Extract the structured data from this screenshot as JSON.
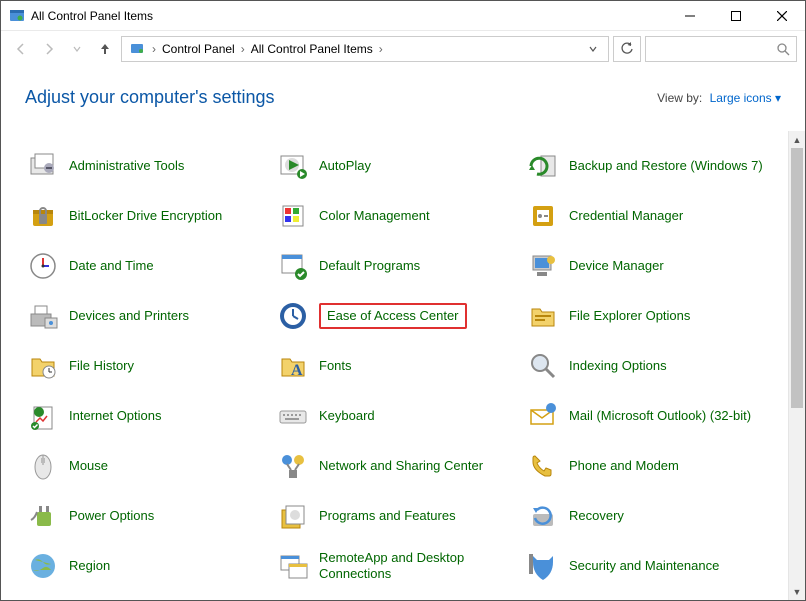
{
  "window": {
    "title": "All Control Panel Items"
  },
  "breadcrumb": {
    "seg1": "Control Panel",
    "seg2": "All Control Panel Items"
  },
  "header": {
    "title": "Adjust your computer's settings",
    "viewby_label": "View by:",
    "viewby_value": "Large icons"
  },
  "items": [
    {
      "label": "Administrative Tools",
      "icon": "admin-tools"
    },
    {
      "label": "AutoPlay",
      "icon": "autoplay"
    },
    {
      "label": "Backup and Restore (Windows 7)",
      "icon": "backup"
    },
    {
      "label": "BitLocker Drive Encryption",
      "icon": "bitlocker"
    },
    {
      "label": "Color Management",
      "icon": "color-mgmt"
    },
    {
      "label": "Credential Manager",
      "icon": "credential"
    },
    {
      "label": "Date and Time",
      "icon": "datetime"
    },
    {
      "label": "Default Programs",
      "icon": "default-programs"
    },
    {
      "label": "Device Manager",
      "icon": "device-mgr"
    },
    {
      "label": "Devices and Printers",
      "icon": "devices-printers"
    },
    {
      "label": "Ease of Access Center",
      "icon": "ease-access",
      "highlight": true
    },
    {
      "label": "File Explorer Options",
      "icon": "file-explorer"
    },
    {
      "label": "File History",
      "icon": "file-history"
    },
    {
      "label": "Fonts",
      "icon": "fonts"
    },
    {
      "label": "Indexing Options",
      "icon": "indexing"
    },
    {
      "label": "Internet Options",
      "icon": "internet"
    },
    {
      "label": "Keyboard",
      "icon": "keyboard"
    },
    {
      "label": "Mail (Microsoft Outlook) (32-bit)",
      "icon": "mail"
    },
    {
      "label": "Mouse",
      "icon": "mouse"
    },
    {
      "label": "Network and Sharing Center",
      "icon": "network"
    },
    {
      "label": "Phone and Modem",
      "icon": "phone"
    },
    {
      "label": "Power Options",
      "icon": "power"
    },
    {
      "label": "Programs and Features",
      "icon": "programs"
    },
    {
      "label": "Recovery",
      "icon": "recovery"
    },
    {
      "label": "Region",
      "icon": "region"
    },
    {
      "label": "RemoteApp and Desktop Connections",
      "icon": "remoteapp"
    },
    {
      "label": "Security and Maintenance",
      "icon": "security"
    }
  ]
}
